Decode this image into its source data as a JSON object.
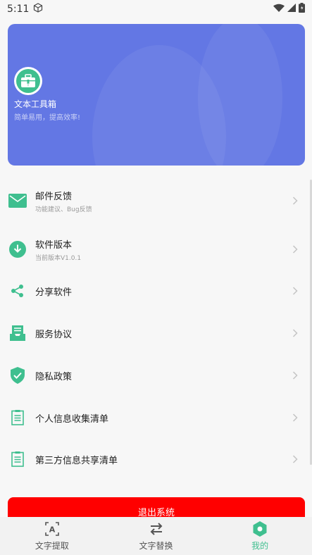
{
  "status": {
    "time": "5:11"
  },
  "header": {
    "app_name": "文本工具箱",
    "slogan": "简单易用，提高效率!"
  },
  "menu": [
    {
      "title": "邮件反馈",
      "subtitle": "功能建议、Bug反馈",
      "icon": "mail-icon"
    },
    {
      "title": "软件版本",
      "subtitle": "当前版本V1.0.1",
      "icon": "download-icon"
    },
    {
      "title": "分享软件",
      "subtitle": "",
      "icon": "share-icon"
    },
    {
      "title": "服务协议",
      "subtitle": "",
      "icon": "inbox-icon"
    },
    {
      "title": "隐私政策",
      "subtitle": "",
      "icon": "shield-check-icon"
    },
    {
      "title": "个人信息收集清单",
      "subtitle": "",
      "icon": "list-icon"
    },
    {
      "title": "第三方信息共享清单",
      "subtitle": "",
      "icon": "list-icon"
    }
  ],
  "logout_label": "退出系统",
  "nav": [
    {
      "label": "文字提取",
      "icon": "text-extract-icon",
      "active": false
    },
    {
      "label": "文字替换",
      "icon": "swap-icon",
      "active": false
    },
    {
      "label": "我的",
      "icon": "hexagon-icon",
      "active": true
    }
  ],
  "colors": {
    "accent": "#3fbf8f",
    "header_bg": "#6377e4",
    "logout_bg": "#ff0000"
  }
}
